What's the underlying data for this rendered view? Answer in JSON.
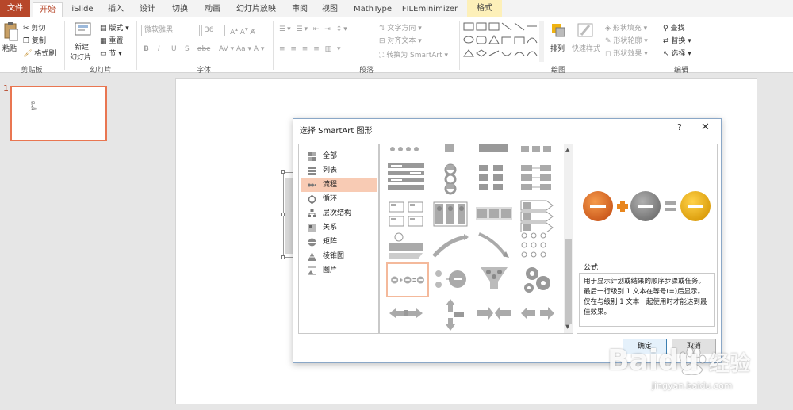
{
  "tabs": [
    "文件",
    "开始",
    "iSlide",
    "插入",
    "设计",
    "切换",
    "动画",
    "幻灯片放映",
    "审阅",
    "视图",
    "MathType",
    "FILEminimizer",
    "格式"
  ],
  "active_tab": "开始",
  "ribbon": {
    "clipboard": {
      "paste": "粘贴",
      "cut": "剪切",
      "copy": "复制",
      "format_painter": "格式刷",
      "label": "剪贴板"
    },
    "slides": {
      "new_slide_line1": "新建",
      "new_slide_line2": "幻灯片",
      "layout": "版式",
      "reset": "重置",
      "section": "节",
      "label": "幻灯片"
    },
    "font": {
      "font_name": "微软雅黑",
      "font_size": "36",
      "bold": "B",
      "italic": "I",
      "underline": "U",
      "strike": "S",
      "shadow": "abc",
      "label": "字体"
    },
    "paragraph": {
      "text_direction": "文字方向",
      "align_text": "对齐文本",
      "convert_smartart": "转换为 SmartArt",
      "label": "段落"
    },
    "drawing": {
      "arrange": "排列",
      "quick_styles": "快速样式",
      "shape_fill": "形状填充",
      "shape_outline": "形状轮廓",
      "shape_effects": "形状效果",
      "label": "绘图"
    },
    "editing": {
      "find": "查找",
      "replace": "替换",
      "select": "选择",
      "label": "编辑"
    }
  },
  "thumbnail": {
    "number": "1",
    "content": [
      "95",
      "1",
      "100"
    ]
  },
  "dialog": {
    "title": "选择 SmartArt 图形",
    "help": "?",
    "close": "✕",
    "categories": [
      "全部",
      "列表",
      "流程",
      "循环",
      "层次结构",
      "关系",
      "矩阵",
      "棱锥图",
      "图片"
    ],
    "selected_category": "流程",
    "preview_title": "公式",
    "preview_description": "用于显示计划或结果的顺序步骤或任务。最后一行级别 1 文本在等号(=)后显示。仅在与级别 1 文本一起使用时才能达到最佳效果。",
    "ok": "确定",
    "cancel": "取消"
  },
  "colors": {
    "brand": "#b7472a",
    "selected_category": "#f8cbb4",
    "thumb_border": "#e97651",
    "preview_orange": "#e5711f",
    "preview_gray": "#8d8d8d",
    "preview_gold": "#f0b312",
    "preview_plus": "#e8861e"
  },
  "watermark": {
    "brand": "Baidu",
    "product": "经验",
    "url": "jingyan.baidu.com"
  }
}
